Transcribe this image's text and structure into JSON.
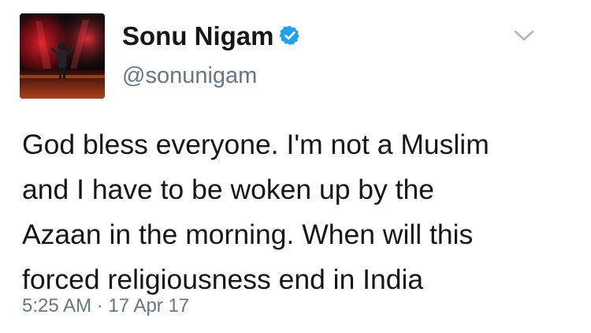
{
  "tweet": {
    "display_name": "Sonu Nigam",
    "handle": "@sonunigam",
    "verified": true,
    "text_lines": [
      "God bless everyone. I'm not a Muslim",
      "and I have to be woken up by the",
      "Azaan in the morning. When will this",
      "forced religiousness end in India"
    ],
    "time": "5:25 AM",
    "separator": "·",
    "date": "17 Apr 17",
    "icons": {
      "verified": "verified-badge-icon",
      "menu": "chevron-down-icon"
    },
    "colors": {
      "name": "#14171a",
      "secondary": "#657786",
      "verified": "#1da1f2",
      "chevron": "#aab8c2"
    }
  }
}
